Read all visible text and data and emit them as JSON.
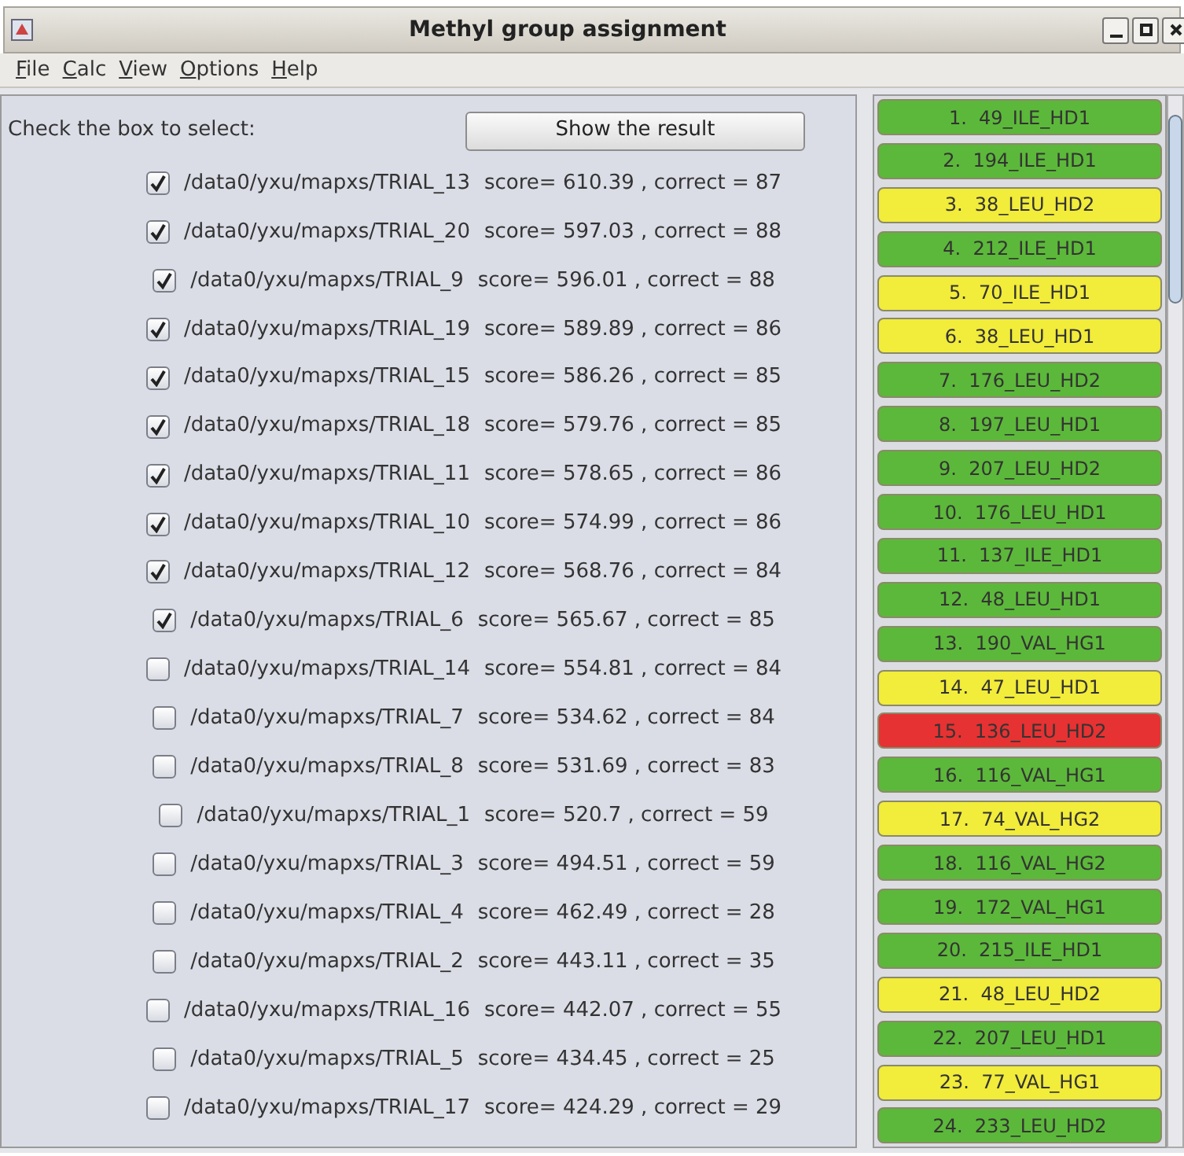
{
  "window": {
    "title": "Methyl group assignment"
  },
  "menu": [
    "File",
    "Calc",
    "View",
    "Options",
    "Help"
  ],
  "instruction": "Check the box to select:",
  "show_button": "Show the result",
  "trials": [
    {
      "path": "/data0/yxu/mapxs/TRIAL_13",
      "result": "score= 610.39 , correct = 87",
      "checked": true
    },
    {
      "path": "/data0/yxu/mapxs/TRIAL_20",
      "result": "score= 597.03 , correct = 88",
      "checked": true
    },
    {
      "path": "/data0/yxu/mapxs/TRIAL_9",
      "result": "score= 596.01 , correct = 88",
      "checked": true
    },
    {
      "path": "/data0/yxu/mapxs/TRIAL_19",
      "result": "score= 589.89 , correct = 86",
      "checked": true
    },
    {
      "path": "/data0/yxu/mapxs/TRIAL_15",
      "result": "score= 586.26 , correct = 85",
      "checked": true
    },
    {
      "path": "/data0/yxu/mapxs/TRIAL_18",
      "result": "score= 579.76 , correct = 85",
      "checked": true
    },
    {
      "path": "/data0/yxu/mapxs/TRIAL_11",
      "result": "score= 578.65 , correct = 86",
      "checked": true
    },
    {
      "path": "/data0/yxu/mapxs/TRIAL_10",
      "result": "score= 574.99 , correct = 86",
      "checked": true
    },
    {
      "path": "/data0/yxu/mapxs/TRIAL_12",
      "result": "score= 568.76 , correct = 84",
      "checked": true
    },
    {
      "path": "/data0/yxu/mapxs/TRIAL_6",
      "result": "score= 565.67 , correct = 85",
      "checked": true
    },
    {
      "path": "/data0/yxu/mapxs/TRIAL_14",
      "result": "score= 554.81 , correct = 84",
      "checked": false
    },
    {
      "path": "/data0/yxu/mapxs/TRIAL_7",
      "result": "score= 534.62 , correct = 84",
      "checked": false
    },
    {
      "path": "/data0/yxu/mapxs/TRIAL_8",
      "result": "score= 531.69 , correct = 83",
      "checked": false
    },
    {
      "path": "/data0/yxu/mapxs/TRIAL_1",
      "result": "score= 520.7 , correct = 59",
      "checked": false
    },
    {
      "path": "/data0/yxu/mapxs/TRIAL_3",
      "result": "score= 494.51 , correct = 59",
      "checked": false
    },
    {
      "path": "/data0/yxu/mapxs/TRIAL_4",
      "result": "score= 462.49 , correct = 28",
      "checked": false
    },
    {
      "path": "/data0/yxu/mapxs/TRIAL_2",
      "result": "score= 443.11 , correct = 35",
      "checked": false
    },
    {
      "path": "/data0/yxu/mapxs/TRIAL_16",
      "result": "score= 442.07 , correct = 55",
      "checked": false
    },
    {
      "path": "/data0/yxu/mapxs/TRIAL_5",
      "result": "score= 434.45 , correct = 25",
      "checked": false
    },
    {
      "path": "/data0/yxu/mapxs/TRIAL_17",
      "result": "score= 424.29 , correct = 29",
      "checked": false
    }
  ],
  "assignments": [
    {
      "label": "1.  49_ILE_HD1",
      "color": "#5cb83a"
    },
    {
      "label": "2.  194_ILE_HD1",
      "color": "#5cb83a"
    },
    {
      "label": "3.  38_LEU_HD2",
      "color": "#f2ec3a"
    },
    {
      "label": "4.  212_ILE_HD1",
      "color": "#5cb83a"
    },
    {
      "label": "5.  70_ILE_HD1",
      "color": "#f2ec3a"
    },
    {
      "label": "6.  38_LEU_HD1",
      "color": "#f2ec3a"
    },
    {
      "label": "7.  176_LEU_HD2",
      "color": "#5cb83a"
    },
    {
      "label": "8.  197_LEU_HD1",
      "color": "#5cb83a"
    },
    {
      "label": "9.  207_LEU_HD2",
      "color": "#5cb83a"
    },
    {
      "label": "10.  176_LEU_HD1",
      "color": "#5cb83a"
    },
    {
      "label": "11.  137_ILE_HD1",
      "color": "#5cb83a"
    },
    {
      "label": "12.  48_LEU_HD1",
      "color": "#5cb83a"
    },
    {
      "label": "13.  190_VAL_HG1",
      "color": "#5cb83a"
    },
    {
      "label": "14.  47_LEU_HD1",
      "color": "#f2ec3a"
    },
    {
      "label": "15.  136_LEU_HD2",
      "color": "#e63232"
    },
    {
      "label": "16.  116_VAL_HG1",
      "color": "#5cb83a"
    },
    {
      "label": "17.  74_VAL_HG2",
      "color": "#f2ec3a"
    },
    {
      "label": "18.  116_VAL_HG2",
      "color": "#5cb83a"
    },
    {
      "label": "19.  172_VAL_HG1",
      "color": "#5cb83a"
    },
    {
      "label": "20.  215_ILE_HD1",
      "color": "#5cb83a"
    },
    {
      "label": "21.  48_LEU_HD2",
      "color": "#f2ec3a"
    },
    {
      "label": "22.  207_LEU_HD1",
      "color": "#5cb83a"
    },
    {
      "label": "23.  77_VAL_HG1",
      "color": "#f2ec3a"
    },
    {
      "label": "24.  233_LEU_HD2",
      "color": "#5cb83a"
    }
  ]
}
